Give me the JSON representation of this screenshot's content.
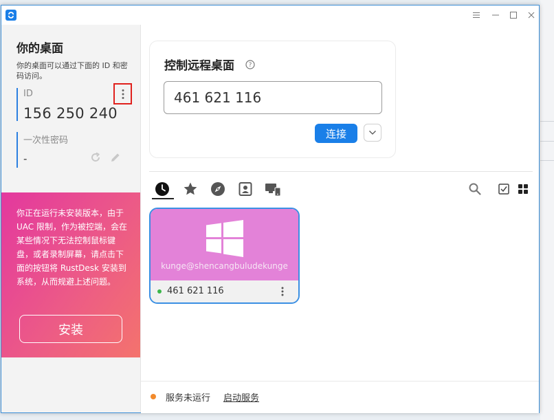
{
  "window": {
    "title_buttons": [
      "menu-icon",
      "minimize-icon",
      "maximize-icon",
      "close-icon"
    ]
  },
  "left": {
    "title": "你的桌面",
    "description": "你的桌面可以通过下面的 ID 和密码访问。",
    "id_label": "ID",
    "id_value": "156 250 240",
    "password_label": "一次性密码",
    "password_value": "-"
  },
  "warning": {
    "text": "你正在运行未安装版本，由于 UAC 限制，作为被控端，会在某些情况下无法控制鼠标键盘，或者录制屏幕，请点击下面的按钮将 RustDesk 安装到系统，从而规避上述问题。",
    "install_label": "安装",
    "gradient_colors": [
      "#e3389e",
      "#f4736d"
    ]
  },
  "control": {
    "title": "控制远程桌面",
    "input_value": "461 621 116",
    "connect_label": "连接",
    "accent_color": "#1a7fe8"
  },
  "tabs": {
    "items": [
      "recent-icon",
      "star-icon",
      "compass-icon",
      "address-book-icon",
      "lan-icon"
    ],
    "active": "recent-icon",
    "right_tools": [
      "search-icon",
      "checkbox-icon",
      "grid-view-icon"
    ]
  },
  "peer": {
    "username": "kunge@shencangbuludekunge",
    "id": "461 621 116",
    "os_icon": "windows-icon",
    "online": true,
    "thumb_color": "#e382d8"
  },
  "status": {
    "text": "服务未运行",
    "link": "启动服务",
    "dot_color": "#f28a2c"
  }
}
